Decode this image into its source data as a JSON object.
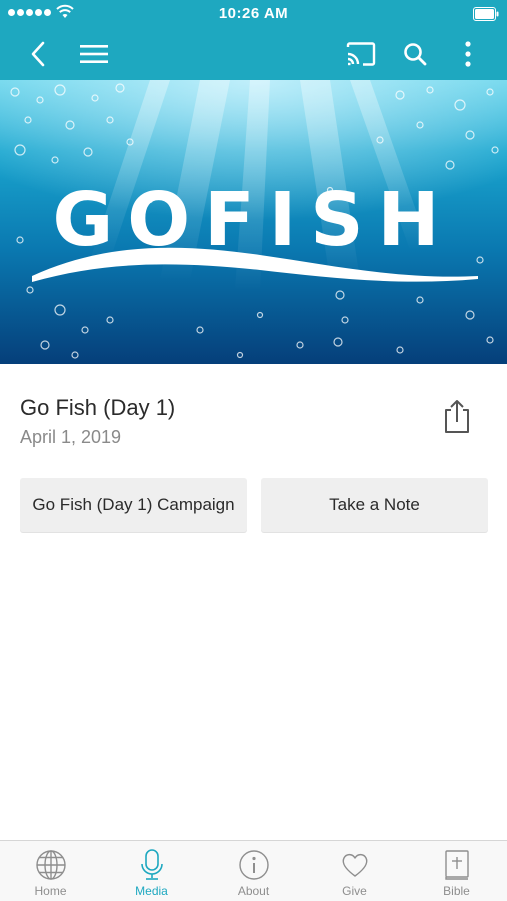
{
  "status_bar": {
    "time": "10:26 AM"
  },
  "nav": {
    "back_icon": "chevron-left-icon",
    "menu_icon": "hamburger-menu-icon",
    "cast_icon": "cast-icon",
    "search_icon": "search-icon",
    "more_icon": "more-vertical-icon"
  },
  "hero": {
    "logo_text": "GOFISH"
  },
  "media": {
    "title": "Go Fish (Day 1)",
    "date": "April 1, 2019"
  },
  "actions": {
    "campaign_label": "Go Fish (Day 1) Campaign",
    "note_label": "Take a Note"
  },
  "tabs": [
    {
      "label": "Home",
      "icon": "globe-icon"
    },
    {
      "label": "Media",
      "icon": "microphone-icon",
      "active": true
    },
    {
      "label": "About",
      "icon": "info-icon"
    },
    {
      "label": "Give",
      "icon": "heart-icon"
    },
    {
      "label": "Bible",
      "icon": "bible-icon"
    }
  ],
  "colors": {
    "brand": "#1ea8c0",
    "button_bg": "#efefef",
    "tab_inactive": "#8e8e8e"
  }
}
